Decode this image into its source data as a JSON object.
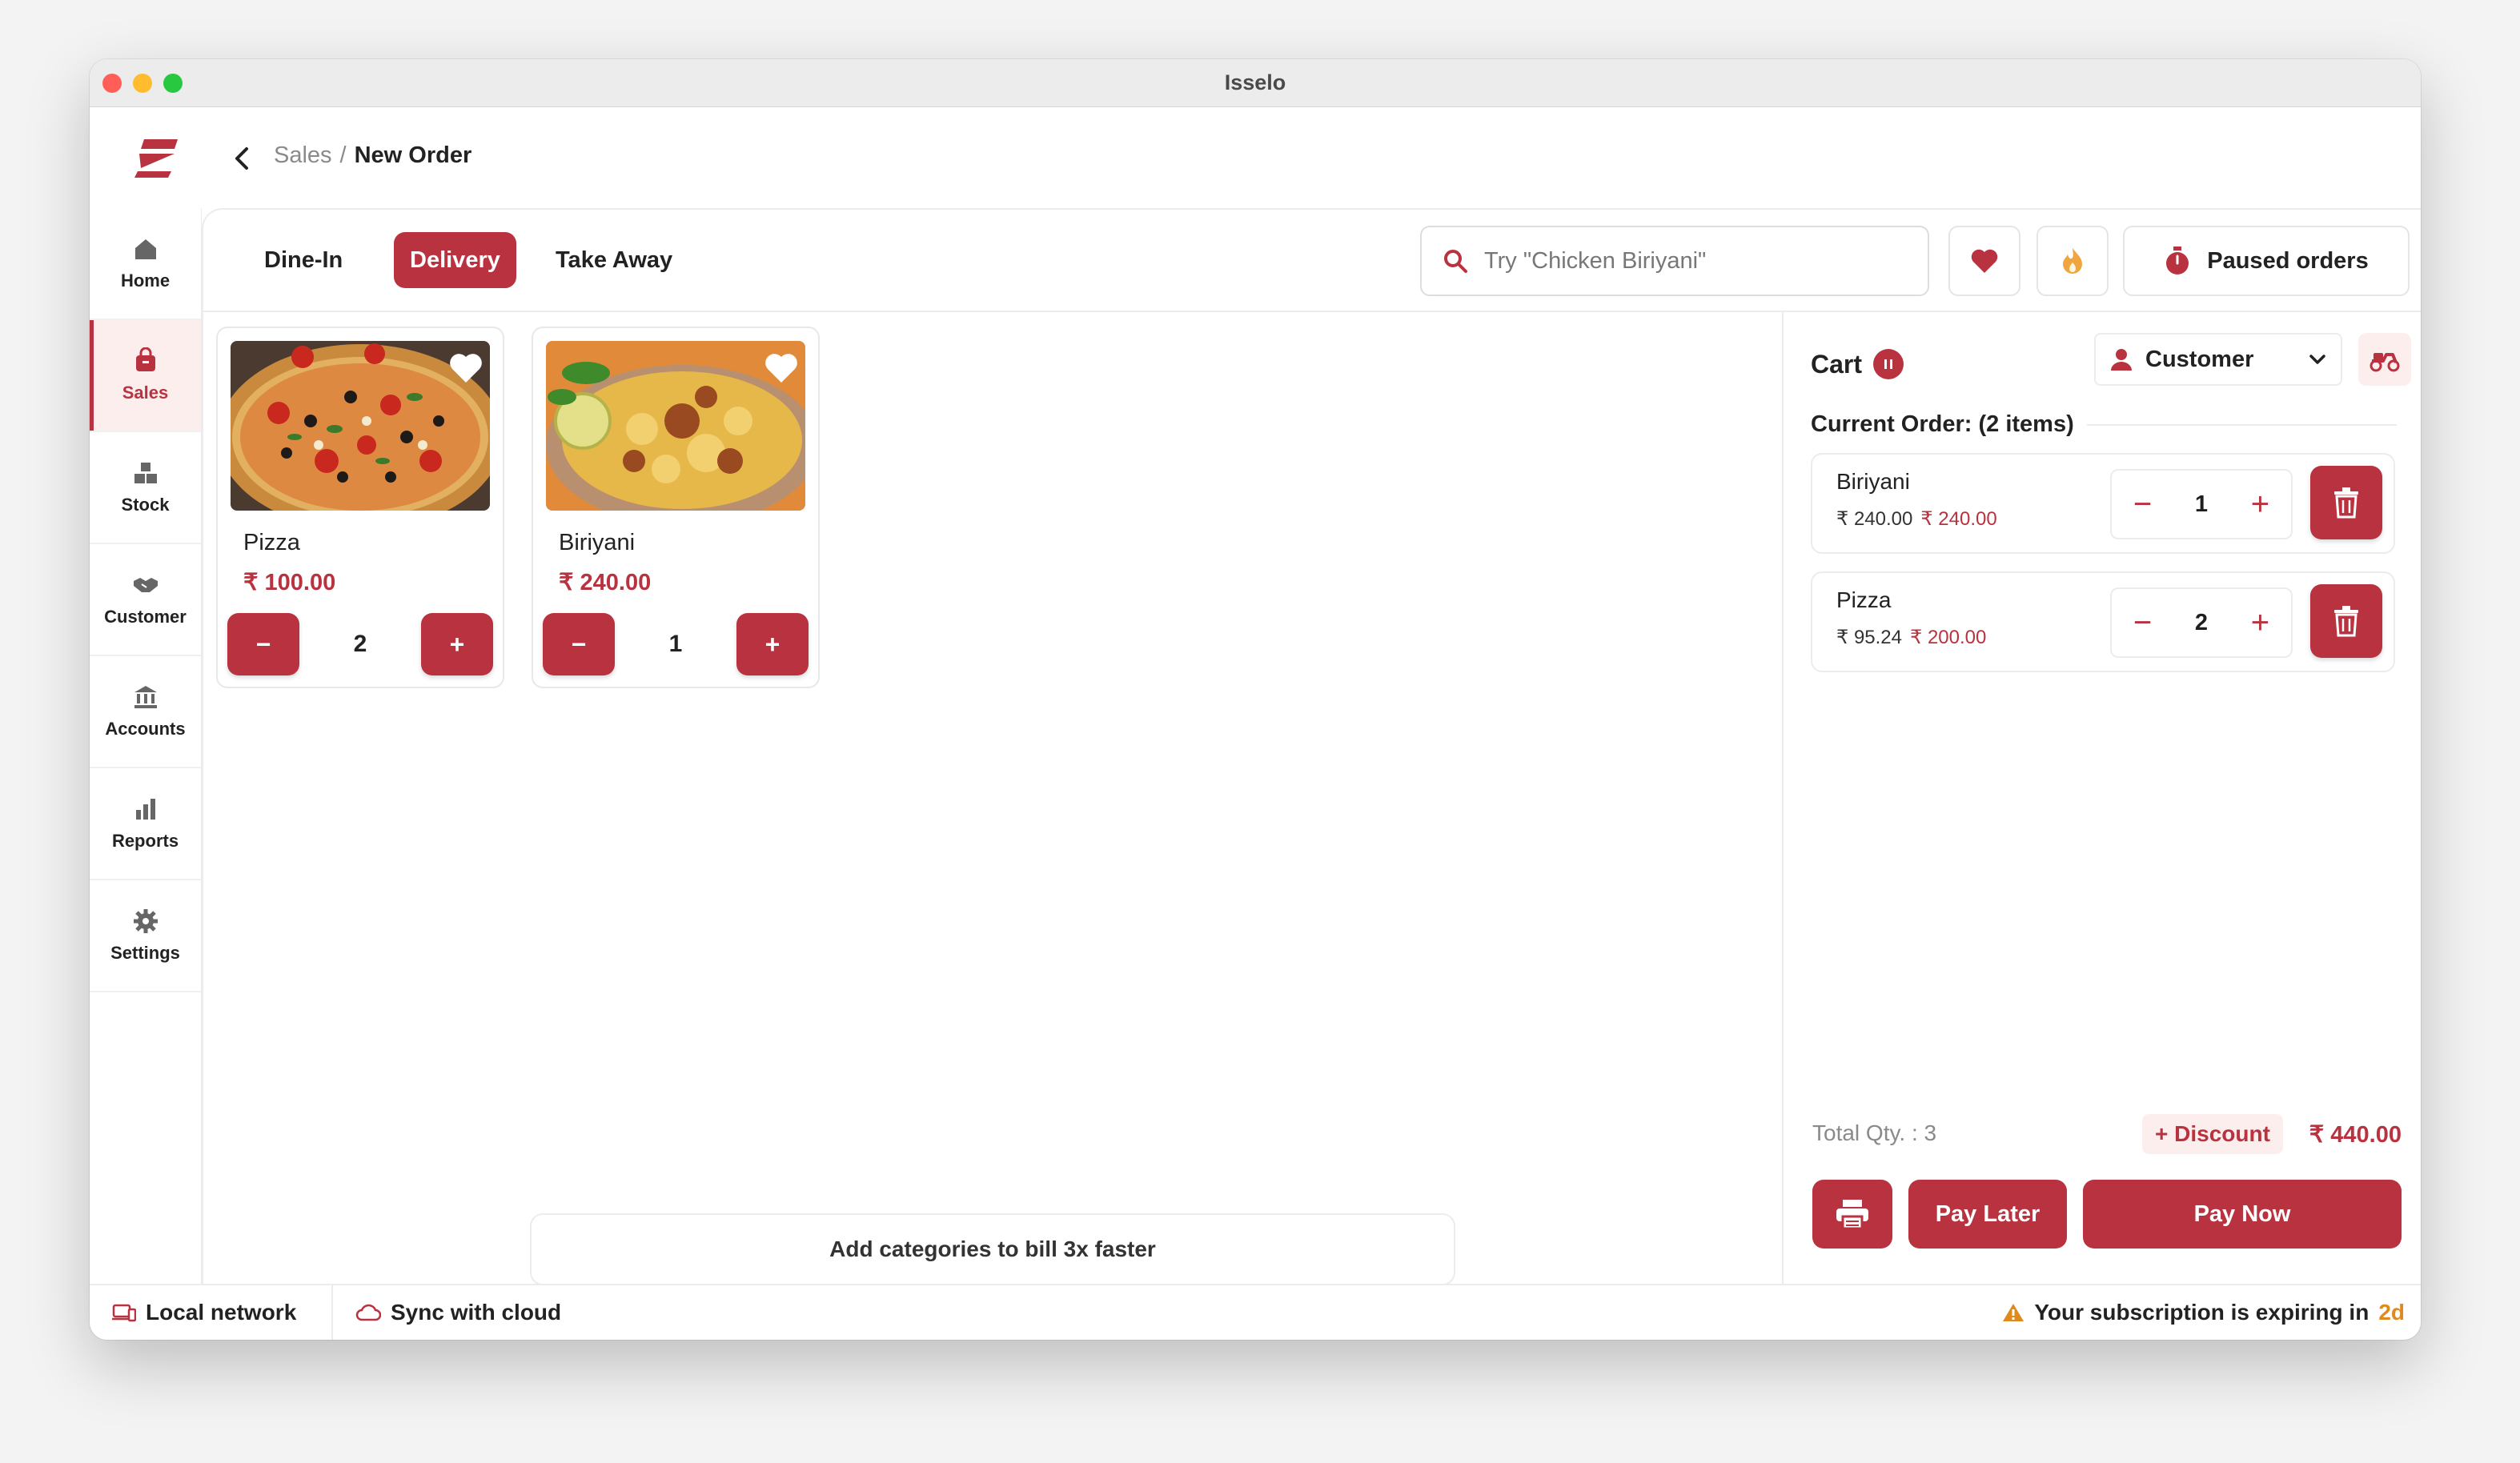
{
  "window": {
    "title": "Isselo"
  },
  "breadcrumb": {
    "parent": "Sales",
    "separator": "/",
    "current": "New Order"
  },
  "sidebar": {
    "items": [
      {
        "label": "Home",
        "icon": "home-icon"
      },
      {
        "label": "Sales",
        "icon": "shopping-bag-icon",
        "active": true
      },
      {
        "label": "Stock",
        "icon": "boxes-icon"
      },
      {
        "label": "Customer",
        "icon": "handshake-icon"
      },
      {
        "label": "Accounts",
        "icon": "bank-icon"
      },
      {
        "label": "Reports",
        "icon": "bar-chart-icon"
      },
      {
        "label": "Settings",
        "icon": "gear-icon"
      }
    ]
  },
  "order_types": {
    "dine_in": "Dine-In",
    "delivery": "Delivery",
    "take_away": "Take Away",
    "selected": "Delivery"
  },
  "search": {
    "placeholder": "Try \"Chicken Biriyani\""
  },
  "toolbar": {
    "favorites_icon": "heart-icon",
    "trending_icon": "flame-icon",
    "paused_orders": "Paused orders"
  },
  "products": [
    {
      "name": "Pizza",
      "price": "₹ 100.00",
      "qty": "2",
      "minus": "−",
      "plus": "+"
    },
    {
      "name": "Biriyani",
      "price": "₹ 240.00",
      "qty": "1",
      "minus": "−",
      "plus": "+"
    }
  ],
  "add_categories": "Add categories to bill 3x faster",
  "cart": {
    "title": "Cart",
    "customer": "Customer",
    "current_order": "Current Order: (2 items)",
    "items": [
      {
        "name": "Biriyani",
        "unit_price": "₹ 240.00",
        "line_total": "₹ 240.00",
        "qty": "1"
      },
      {
        "name": "Pizza",
        "unit_price": "₹ 95.24",
        "line_total": "₹ 200.00",
        "qty": "2"
      }
    ],
    "total_qty": "Total Qty. : 3",
    "discount": "+ Discount",
    "total": "₹ 440.00",
    "pay_later": "Pay Later",
    "pay_now": "Pay Now"
  },
  "status": {
    "local_network": "Local network",
    "sync": "Sync with cloud",
    "subscription": "Your subscription is expiring in",
    "days": "2d"
  },
  "colors": {
    "accent": "#b93240",
    "accent_light": "#fdeeee",
    "warning": "#e08a1e"
  }
}
